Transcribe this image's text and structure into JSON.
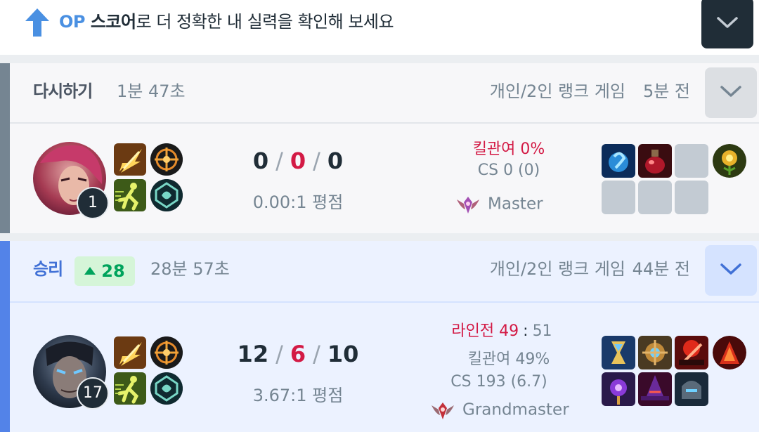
{
  "banner": {
    "op": "OP",
    "score": " 스코어",
    "rest": "로 더 정확한 내 실력을 확인해 보세요"
  },
  "matches": [
    {
      "result": "다시하기",
      "duration": "1분 47초",
      "queue": "개인/2인 랭크 게임",
      "time_ago": "5분 전",
      "level": "1",
      "kills": "0",
      "deaths": "0",
      "assists": "0",
      "kda_ratio": "0.00:1 평점",
      "kill_participation": "킬관여 0%",
      "cs": "CS 0 (0)",
      "tier": "Master",
      "items": [
        "frost-orb-item",
        "potion-item",
        "empty",
        "golden-flower-item",
        "empty",
        "empty",
        "empty"
      ]
    },
    {
      "result": "승리",
      "lp_change": "28",
      "duration": "28분 57초",
      "queue": "개인/2인 랭크 게임",
      "time_ago": "44분 전",
      "level": "17",
      "kills": "12",
      "deaths": "6",
      "assists": "10",
      "kda_ratio": "3.67:1 평점",
      "laning_label": "라인전 49",
      "laning_sep": ":",
      "laning_opp": "51",
      "kill_participation": "킬관여 49%",
      "cs": "CS 193 (6.7)",
      "tier": "Grandmaster",
      "items": [
        "hourglass-item",
        "clockwork-item",
        "red-blade-item",
        "flame-cape-item",
        "void-staff-item",
        "witch-hat-item",
        "iron-helm-item"
      ]
    }
  ],
  "colors": {
    "accent_blue": "#5383e8",
    "remake_grey": "#758592",
    "death_red": "#d31a45",
    "lp_green": "#00a35c"
  }
}
